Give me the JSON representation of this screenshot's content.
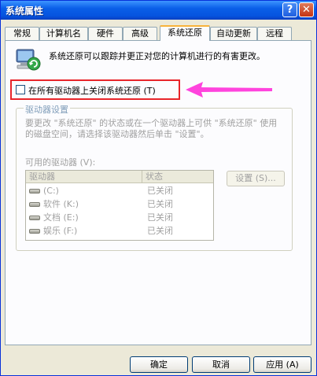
{
  "window": {
    "title": "系统属性",
    "help_label": "?",
    "close_label": "✕"
  },
  "tabs": [
    {
      "label": "常规"
    },
    {
      "label": "计算机名"
    },
    {
      "label": "硬件"
    },
    {
      "label": "高级"
    },
    {
      "label": "系统还原",
      "active": true
    },
    {
      "label": "自动更新"
    },
    {
      "label": "远程"
    }
  ],
  "intro": {
    "text": "系统还原可以跟踪并更正对您的计算机进行的有害更改。",
    "icon": "system-restore-icon"
  },
  "disable_all": {
    "label": "在所有驱动器上关闭系统还原 (T)",
    "checked": false
  },
  "annotation": {
    "color": "#ff44dd",
    "box_color": "#e8252a"
  },
  "drive_settings": {
    "title": "驱动器设置",
    "description": "要更改 \"系统还原\" 的状态或在一个驱动器上可供 \"系统还原\" 使用的磁盘空间，请选择该驱动器然后单击 \"设置\"。",
    "available_label": "可用的驱动器 (V):",
    "columns": [
      "驱动器",
      "状态"
    ],
    "rows": [
      {
        "drive": "(C:)",
        "status": "已关闭"
      },
      {
        "drive": "软件  (K:)",
        "status": "已关闭"
      },
      {
        "drive": "文档  (E:)",
        "status": "已关闭"
      },
      {
        "drive": "娱乐  (F:)",
        "status": "已关闭"
      }
    ],
    "settings_button": "设置 (S)..."
  },
  "buttons": {
    "ok": "确定",
    "cancel": "取消",
    "apply": "应用 (A)"
  }
}
